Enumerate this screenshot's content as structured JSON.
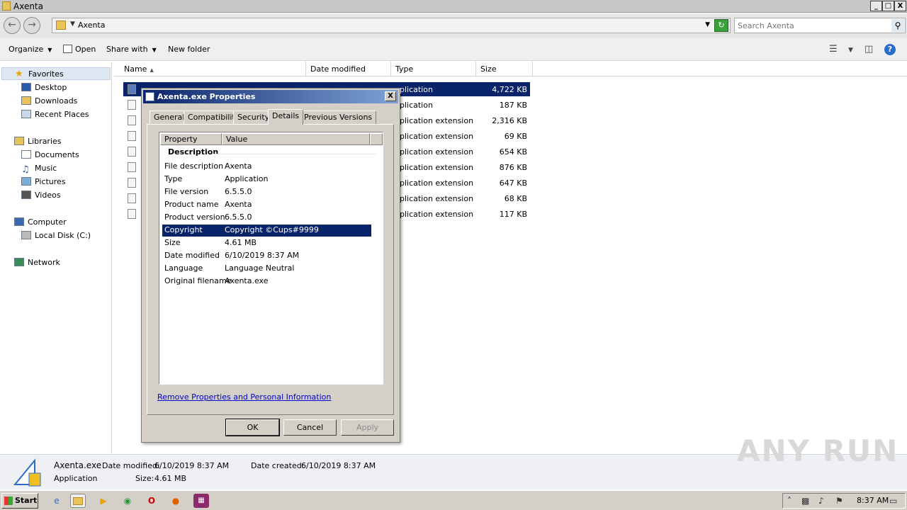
{
  "window": {
    "title": "Axenta",
    "min": "_",
    "max": "□",
    "close": "X"
  },
  "address": {
    "breadcrumb": "Axenta",
    "search_placeholder": "Search Axenta"
  },
  "toolbar": {
    "organize": "Organize",
    "open": "Open",
    "share_with": "Share with",
    "new_folder": "New folder"
  },
  "nav": {
    "favorites": "Favorites",
    "desktop": "Desktop",
    "downloads": "Downloads",
    "recent_places": "Recent Places",
    "libraries": "Libraries",
    "documents": "Documents",
    "music": "Music",
    "pictures": "Pictures",
    "videos": "Videos",
    "computer": "Computer",
    "local_disk": "Local Disk (C:)",
    "network": "Network"
  },
  "columns": {
    "name": "Name",
    "date_modified": "Date modified",
    "type": "Type",
    "size": "Size"
  },
  "files": [
    {
      "type": "pplication",
      "size": "4,722 KB",
      "selected": true
    },
    {
      "type": "pplication",
      "size": "187 KB"
    },
    {
      "type": "pplication extension",
      "size": "2,316 KB"
    },
    {
      "type": "pplication extension",
      "size": "69 KB"
    },
    {
      "type": "pplication extension",
      "size": "654 KB"
    },
    {
      "type": "pplication extension",
      "size": "876 KB"
    },
    {
      "type": "pplication extension",
      "size": "647 KB"
    },
    {
      "type": "pplication extension",
      "size": "68 KB"
    },
    {
      "type": "pplication extension",
      "size": "117 KB"
    }
  ],
  "dialog": {
    "title": "Axenta.exe Properties",
    "close": "X",
    "tabs": [
      "General",
      "Compatibility",
      "Security",
      "Details",
      "Previous Versions"
    ],
    "active_tab": "Details",
    "col_property": "Property",
    "col_value": "Value",
    "section": "Description",
    "properties": [
      {
        "key": "File description",
        "value": "Axenta"
      },
      {
        "key": "Type",
        "value": "Application"
      },
      {
        "key": "File version",
        "value": "6.5.5.0"
      },
      {
        "key": "Product name",
        "value": "Axenta"
      },
      {
        "key": "Product version",
        "value": "6.5.5.0"
      },
      {
        "key": "Copyright",
        "value": "Copyright ©Cups#9999",
        "selected": true
      },
      {
        "key": "Size",
        "value": "4.61 MB"
      },
      {
        "key": "Date modified",
        "value": "6/10/2019 8:37 AM"
      },
      {
        "key": "Language",
        "value": "Language Neutral"
      },
      {
        "key": "Original filename",
        "value": "Axenta.exe"
      }
    ],
    "remove_link": "Remove Properties and Personal Information",
    "ok": "OK",
    "cancel": "Cancel",
    "apply": "Apply"
  },
  "details_pane": {
    "filename": "Axenta.exe",
    "date_modified_label": "Date modified:",
    "date_modified": "6/10/2019 8:37 AM",
    "date_created_label": "Date created:",
    "date_created": "6/10/2019 8:37 AM",
    "type": "Application",
    "size_label": "Size:",
    "size": "4.61 MB"
  },
  "watermark": "ANY RUN",
  "taskbar": {
    "start": "Start",
    "clock": "8:37 AM"
  },
  "colors": {
    "selection": "#0a246a",
    "dialog_face": "#d4d0c8",
    "link": "#0000cc"
  }
}
